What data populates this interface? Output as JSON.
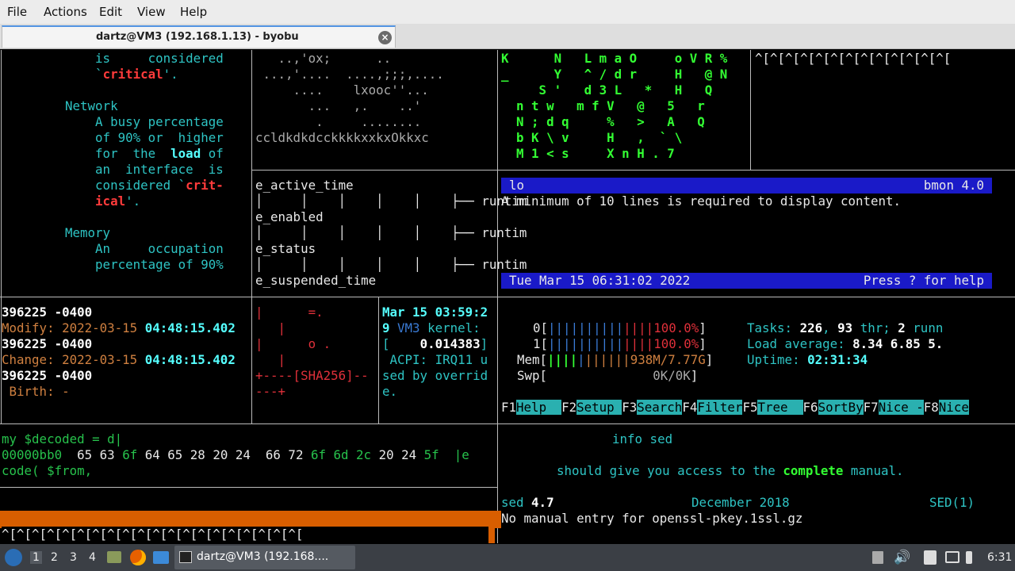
{
  "menu": [
    "File",
    "Actions",
    "Edit",
    "View",
    "Help"
  ],
  "tab": {
    "title": "dartz@VM3 (192.168.1.13) - byobu",
    "close": "×"
  },
  "pane_tl": [
    {
      "seg": [
        [
          "    is     considered",
          "cy"
        ]
      ]
    },
    {
      "seg": [
        [
          "    `",
          "cy"
        ],
        [
          "critical",
          "rdb"
        ],
        [
          "'.",
          "cy"
        ]
      ]
    },
    {
      "seg": [
        [
          "",
          ""
        ]
      ]
    },
    {
      "seg": [
        [
          "Network",
          "cy"
        ]
      ]
    },
    {
      "seg": [
        [
          "    A busy percentage",
          "cy"
        ]
      ]
    },
    {
      "seg": [
        [
          "    of 90% or  higher",
          "cy"
        ]
      ]
    },
    {
      "seg": [
        [
          "    for  the  ",
          "cy"
        ],
        [
          "load",
          "cb"
        ],
        [
          " of",
          "cy"
        ]
      ]
    },
    {
      "seg": [
        [
          "    an  interface  is",
          "cy"
        ]
      ]
    },
    {
      "seg": [
        [
          "    considered `",
          "cy"
        ],
        [
          "crit-",
          "rdb"
        ]
      ]
    },
    {
      "seg": [
        [
          "    ical",
          "rdb"
        ],
        [
          "'.",
          "cy"
        ]
      ]
    },
    {
      "seg": [
        [
          "",
          ""
        ]
      ]
    },
    {
      "seg": [
        [
          "Memory",
          "cy"
        ]
      ]
    },
    {
      "seg": [
        [
          "    An     occupation",
          "cy"
        ]
      ]
    },
    {
      "seg": [
        [
          "    percentage of 90%",
          "cy"
        ]
      ]
    }
  ],
  "pane_tm_art": [
    "   ..,'ox;      ..",
    " ...,'....  ....,;;;,....",
    "     ....    lxooc''...",
    "       ...   ,.    ..'",
    "        .     ........",
    "ccldkdkdcckkkkxxkxOkkxc"
  ],
  "pane_tm_tree": [
    "e_active_time",
    "│     │    │    │    │    ├── runtim",
    "e_enabled",
    "│     │    │    │    │    ├── runtim",
    "e_status",
    "│     │    │    │    │    ├── runtim",
    "e_suspended_time"
  ],
  "matrix": [
    "K      N   L m a O     o V R %",
    "_      Y   ^ / d r     H   @ N",
    "     S '   d 3 L   *   H   Q",
    "  n t w   m f V   @   5   r",
    "  N ; d q     %   >   A   Q",
    "  b K \\ v     H   ,  ` \\",
    "  M 1 < s     X n H . 7"
  ],
  "matrix_right": "^[^[^[^[^[^[^[^[^[^[^[^[^[",
  "bmon": {
    "name": "lo",
    "version": "bmon 4.0",
    "message": "A minimum of 10 lines is required to display content.",
    "date": "Tue Mar 15 06:31:02 2022",
    "help": "Press ? for help"
  },
  "stat": [
    [
      [
        "396225 -0400",
        "whb"
      ]
    ],
    [
      [
        "Modify: 2022-03-15 ",
        "or"
      ],
      [
        "04:48:15.402",
        "cb"
      ]
    ],
    [
      [
        "396225 -0400",
        "whb"
      ]
    ],
    [
      [
        "Change: 2022-03-15 ",
        "or"
      ],
      [
        "04:48:15.402",
        "cb"
      ]
    ],
    [
      [
        "396225 -0400",
        "whb"
      ]
    ],
    [
      [
        " Birth: -",
        "or"
      ]
    ]
  ],
  "sha": [
    "|      =.",
    "   |",
    "|      o .",
    "   |",
    "+----[SHA256]--",
    "---+"
  ],
  "kern": [
    [
      [
        "Mar 15 03:59:2",
        "cb"
      ]
    ],
    [
      [
        "9 ",
        "cb"
      ],
      [
        "VM3",
        "bl"
      ],
      [
        " kernel:",
        "cy"
      ]
    ],
    [
      [
        "[    ",
        "cy"
      ],
      [
        "0.014383",
        "whb"
      ],
      [
        "]",
        "cy"
      ]
    ],
    [
      [
        " ACPI: IRQ11 u",
        "cy"
      ]
    ],
    [
      [
        "sed by overrid",
        "cy"
      ]
    ],
    [
      [
        "e.",
        "cy"
      ]
    ]
  ],
  "htop": {
    "cpu0": "0[",
    "cpu0v": "100.0%",
    "cpu1": "1[",
    "cpu1v": "100.0%",
    "mem": "Mem[",
    "memv": "938M/7.77G",
    "swp": "Swp[",
    "swpv": "0K/0K",
    "tasks_label": "Tasks: ",
    "tasks": "226",
    "thr_label": ", ",
    "thr": "93",
    "thr_txt": " thr; ",
    "run": "2",
    "run_txt": " runn",
    "load_label": "Load average: ",
    "load": "8.34 6.85 5.",
    "uptime_label": "Uptime: ",
    "uptime": "02:31:34",
    "fkeys": [
      [
        "F1",
        "Help  "
      ],
      [
        "F2",
        "Setup "
      ],
      [
        "F3",
        "Search"
      ],
      [
        "F4",
        "Filter"
      ],
      [
        "F5",
        "Tree  "
      ],
      [
        "F6",
        "SortBy"
      ],
      [
        "F7",
        "Nice -"
      ],
      [
        "F8",
        "Nice"
      ]
    ]
  },
  "perl": [
    [
      [
        "my $decoded = d|",
        "gr"
      ]
    ],
    [
      [
        "00000bb0  ",
        "gr"
      ],
      [
        "65 63 ",
        "wh"
      ],
      [
        "6f ",
        "gr"
      ],
      [
        "64 65 28 20 24  66 72 ",
        "wh"
      ],
      [
        "6f 6d 2c ",
        "gr"
      ],
      [
        "20 24 ",
        "wh"
      ],
      [
        "5f",
        "gr"
      ],
      [
        "  |e",
        "gr"
      ]
    ],
    [
      [
        "code( $from,",
        "gr"
      ]
    ]
  ],
  "manpage": {
    "l1": "info sed",
    "l2a": "should give you access to the ",
    "l2b": "complete",
    "l2c": " manual.",
    "sed": "sed ",
    "ver": "4.7",
    "date": "December 2018",
    "sec": "SED(1)",
    "nomanual": "No manual entry for openssl-pkey.1ssl.gz"
  },
  "prompt_esc": "^[^[^[^[^[^[^[^[^[^[^[^[^[^[^[^[^[^[^[^[",
  "taskbar": {
    "workspaces": [
      "1",
      "2",
      "3",
      "4"
    ],
    "window": "dartz@VM3 (192.168....",
    "time": "6:31"
  }
}
